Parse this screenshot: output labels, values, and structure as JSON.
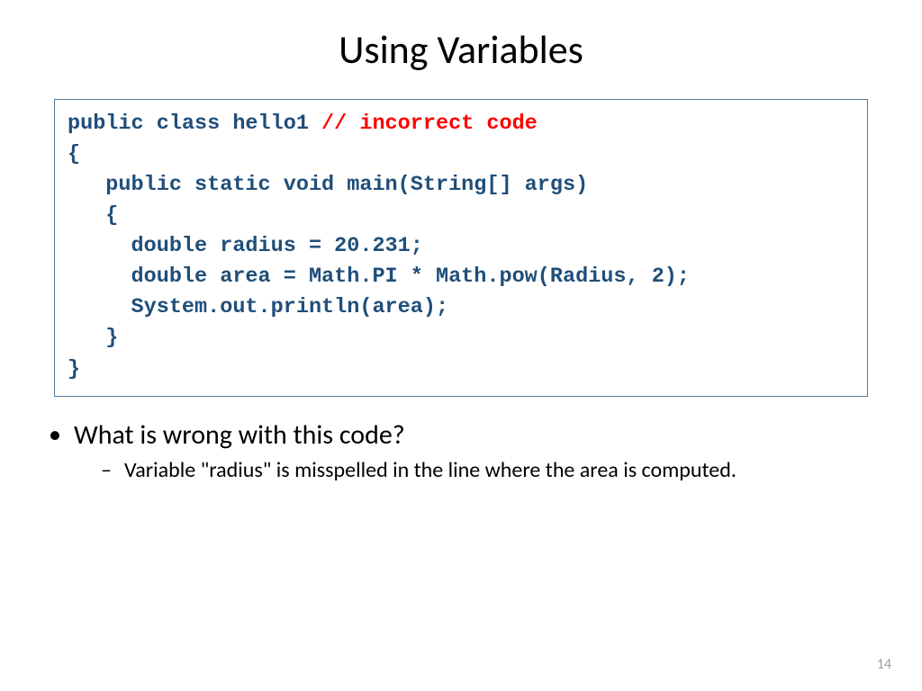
{
  "title": "Using Variables",
  "code": {
    "line1a": "public class hello1 ",
    "line1b": "// incorrect code",
    "line2": "{",
    "line3": "   public static void main(String[] args)",
    "line4": "   {",
    "line5": "     double radius = 20.231;",
    "line6": "     double area = Math.PI * Math.pow(Radius, 2);",
    "line7": "     System.out.println(area);",
    "line8": "   }",
    "line9": "}"
  },
  "bullets": {
    "q": "What is wrong with this code?",
    "a": "Variable  \"radius\" is misspelled in the line where the area is computed."
  },
  "pageNumber": "14"
}
